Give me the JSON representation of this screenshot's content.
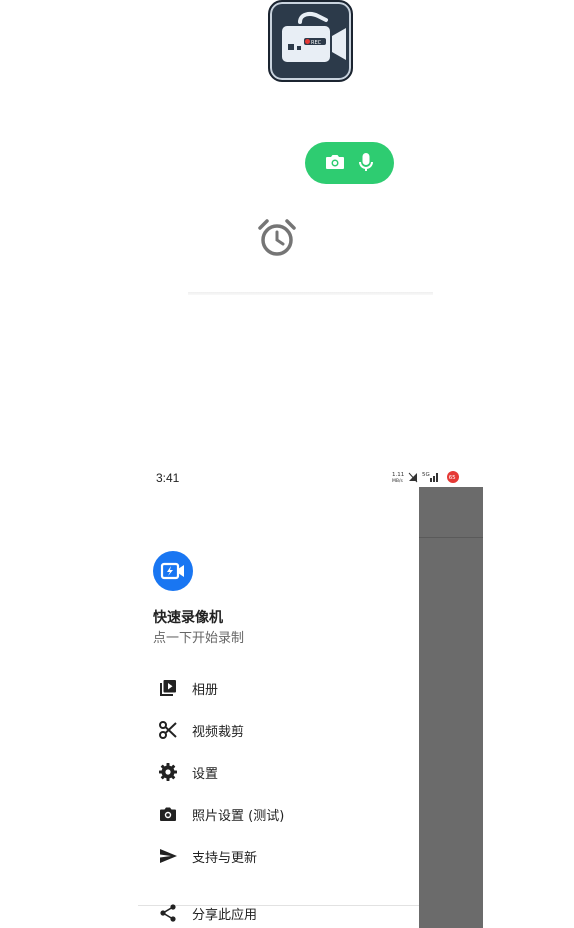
{
  "status_bar": {
    "time": "3:41",
    "net_speed_top": "1.11",
    "net_speed_bottom": "MB/s",
    "net_type": "5G",
    "battery": "65"
  },
  "drawer": {
    "app_name": "快速录像机",
    "subtitle": "点一下开始录制",
    "items": [
      {
        "label": "相册",
        "icon": "video-library-icon"
      },
      {
        "label": "视频裁剪",
        "icon": "scissors-icon"
      },
      {
        "label": "设置",
        "icon": "gear-icon"
      },
      {
        "label": "照片设置 (测试)",
        "icon": "camera-icon"
      },
      {
        "label": "支持与更新",
        "icon": "send-icon"
      }
    ],
    "share_item": {
      "label": "分享此应用",
      "icon": "share-icon"
    }
  },
  "colors": {
    "pill_green": "#2ecc71",
    "avatar_blue": "#1976f2",
    "scrim_gray": "#6b6b6b",
    "logo_dark": "#2c3a4a",
    "rec_red": "#e53935"
  },
  "logo_text": "REC"
}
